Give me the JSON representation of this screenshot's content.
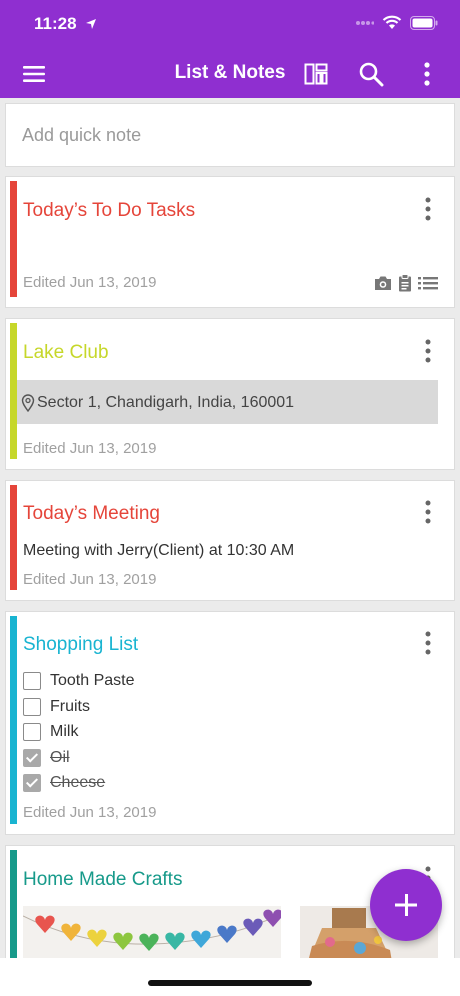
{
  "status_bar": {
    "time": "11:28"
  },
  "appbar": {
    "title": "List & Notes",
    "icons": [
      "menu-icon",
      "layout-icon",
      "search-icon",
      "more-vertical-icon"
    ]
  },
  "quick_note": {
    "placeholder": "Add quick note",
    "value": ""
  },
  "colors": {
    "brand": "#8f2fd0",
    "red": "#e5453a",
    "lime": "#c6d72a",
    "cyan": "#19b4d1",
    "teal": "#179a8a"
  },
  "cards": [
    {
      "title": "Today’s To Do Tasks",
      "edited": "Edited Jun 13, 2019",
      "attachments": [
        "camera-icon",
        "clipboard-icon",
        "list-icon"
      ]
    },
    {
      "title": "Lake Club",
      "location": "Sector 1, Chandigarh, India, 160001",
      "edited": "Edited Jun 13, 2019"
    },
    {
      "title": "Today’s Meeting",
      "body": "Meeting with Jerry(Client) at 10:30 AM",
      "edited": "Edited Jun 13, 2019"
    },
    {
      "title": "Shopping List",
      "items": [
        {
          "label": "Tooth Paste",
          "checked": false
        },
        {
          "label": "Fruits",
          "checked": false
        },
        {
          "label": "Milk",
          "checked": false
        },
        {
          "label": "Oil",
          "checked": true
        },
        {
          "label": "Cheese",
          "checked": true
        }
      ],
      "edited": "Edited Jun 13, 2019"
    },
    {
      "title": "Home Made Crafts"
    }
  ],
  "fab": {
    "icon": "plus-icon"
  }
}
